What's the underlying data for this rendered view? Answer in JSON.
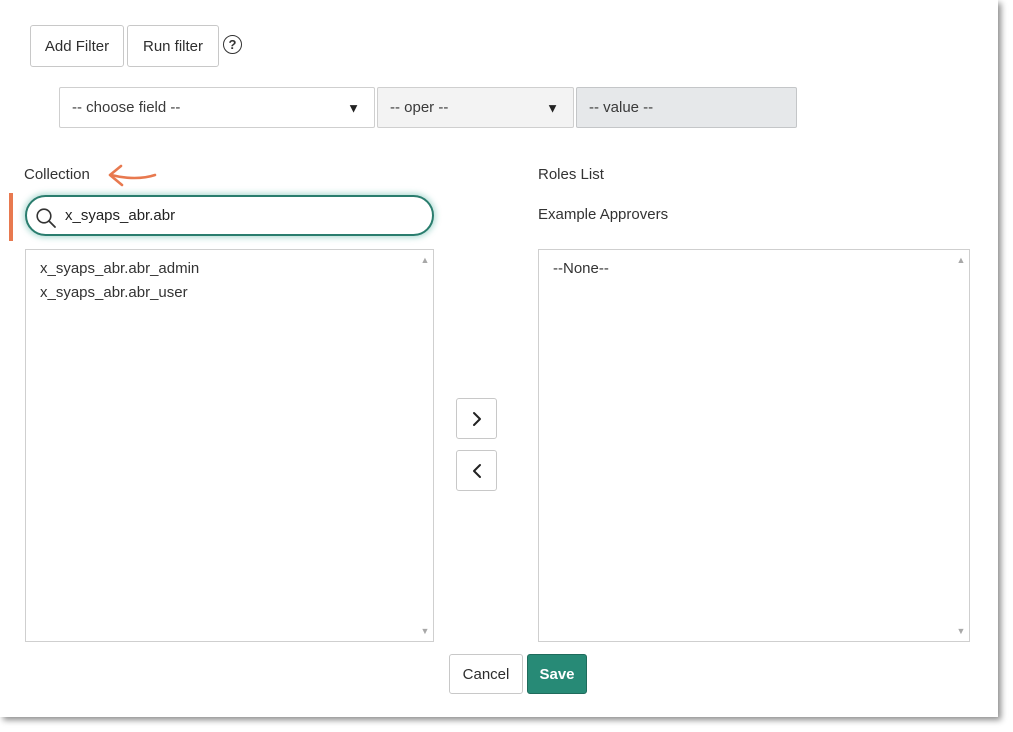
{
  "toolbar": {
    "add_filter_label": "Add Filter",
    "run_filter_label": "Run filter",
    "help_glyph": "?"
  },
  "filter": {
    "field_label": "-- choose field --",
    "operator_label": "-- oper --",
    "value_label": "-- value --"
  },
  "collection": {
    "label": "Collection",
    "search_value": "x_syaps_abr.abr",
    "items": [
      "x_syaps_abr.abr_admin",
      "x_syaps_abr.abr_user"
    ]
  },
  "roles": {
    "label": "Roles List",
    "sublabel": "Example Approvers",
    "items": [
      "--None--"
    ]
  },
  "actions": {
    "cancel_label": "Cancel",
    "save_label": "Save"
  },
  "colors": {
    "accent": "#278a76",
    "annotation": "#e8794f"
  },
  "icons": {
    "search": "search-icon",
    "add": "chevron-right-icon",
    "remove": "chevron-left-icon",
    "annotation_arrow": "arrow-left-icon"
  }
}
